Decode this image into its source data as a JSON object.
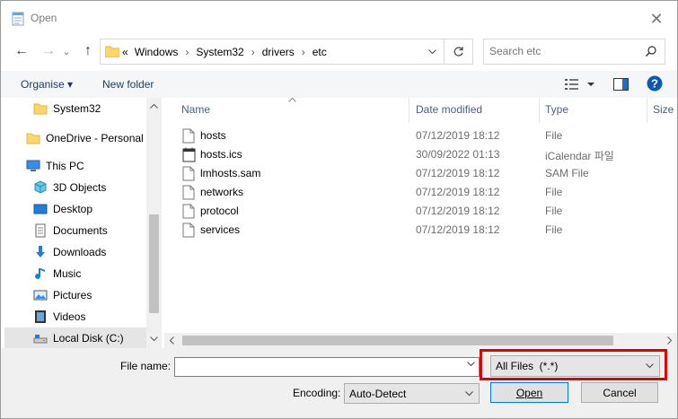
{
  "window": {
    "title": "Open",
    "close": "✕"
  },
  "nav": {
    "back": "←",
    "forward": "→",
    "recent": "⌄",
    "up": "↑"
  },
  "address": {
    "prefix": "«",
    "crumbs": [
      "Windows",
      "System32",
      "drivers",
      "etc"
    ],
    "separator": "›"
  },
  "search": {
    "placeholder": "Search etc"
  },
  "toolbar": {
    "organise": "Organise ▾",
    "new_folder": "New folder"
  },
  "navpane": {
    "items": [
      {
        "label": "System32",
        "icon": "folder-icon"
      },
      {
        "label": "OneDrive - Personal",
        "icon": "onedrive-folder-icon"
      },
      {
        "label": "This PC",
        "icon": "pc-icon"
      },
      {
        "label": "3D Objects",
        "icon": "3d-objects-icon"
      },
      {
        "label": "Desktop",
        "icon": "desktop-icon"
      },
      {
        "label": "Documents",
        "icon": "documents-icon"
      },
      {
        "label": "Downloads",
        "icon": "downloads-icon"
      },
      {
        "label": "Music",
        "icon": "music-icon"
      },
      {
        "label": "Pictures",
        "icon": "pictures-icon"
      },
      {
        "label": "Videos",
        "icon": "videos-icon"
      },
      {
        "label": "Local Disk (C:)",
        "icon": "local-disk-icon"
      }
    ]
  },
  "list": {
    "columns": {
      "name": "Name",
      "date": "Date modified",
      "type": "Type",
      "size": "Size"
    },
    "rows": [
      {
        "name": "hosts",
        "date": "07/12/2019 18:12",
        "type": "File"
      },
      {
        "name": "hosts.ics",
        "date": "30/09/2022 01:13",
        "type": "iCalendar 파일"
      },
      {
        "name": "lmhosts.sam",
        "date": "07/12/2019 18:12",
        "type": "SAM File"
      },
      {
        "name": "networks",
        "date": "07/12/2019 18:12",
        "type": "File"
      },
      {
        "name": "protocol",
        "date": "07/12/2019 18:12",
        "type": "File"
      },
      {
        "name": "services",
        "date": "07/12/2019 18:12",
        "type": "File"
      }
    ]
  },
  "bottom": {
    "file_name_label": "File name:",
    "file_name_value": "",
    "filter_value": "All Files  (*.*)",
    "encoding_label": "Encoding:",
    "encoding_value": "Auto-Detect",
    "open_label": "Open",
    "cancel_label": "Cancel"
  },
  "colors": {
    "accent": "#0078d7",
    "highlight": "#e00000",
    "help": "#0a5ab4"
  }
}
